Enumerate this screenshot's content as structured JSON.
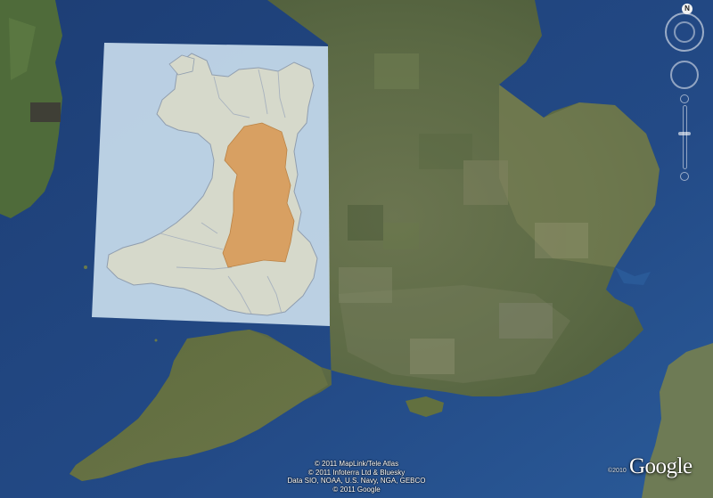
{
  "attribution": {
    "line1": "© 2011 MapLink/Tele Atlas",
    "line2": "© 2011 Infoterra Ltd & Bluesky",
    "line3": "Data SIO, NOAA, U.S. Navy, NGA, GEBCO",
    "line4": "© 2011 Google"
  },
  "logo": {
    "year": "©2010",
    "text": "Google"
  },
  "compass": {
    "north": "N"
  },
  "colors": {
    "sea": "#22447c",
    "land": "#5a6a40",
    "overlay_paper": "#c8dcec",
    "wales_land": "#e6e6d2",
    "highlight_region": "#e8a860"
  }
}
